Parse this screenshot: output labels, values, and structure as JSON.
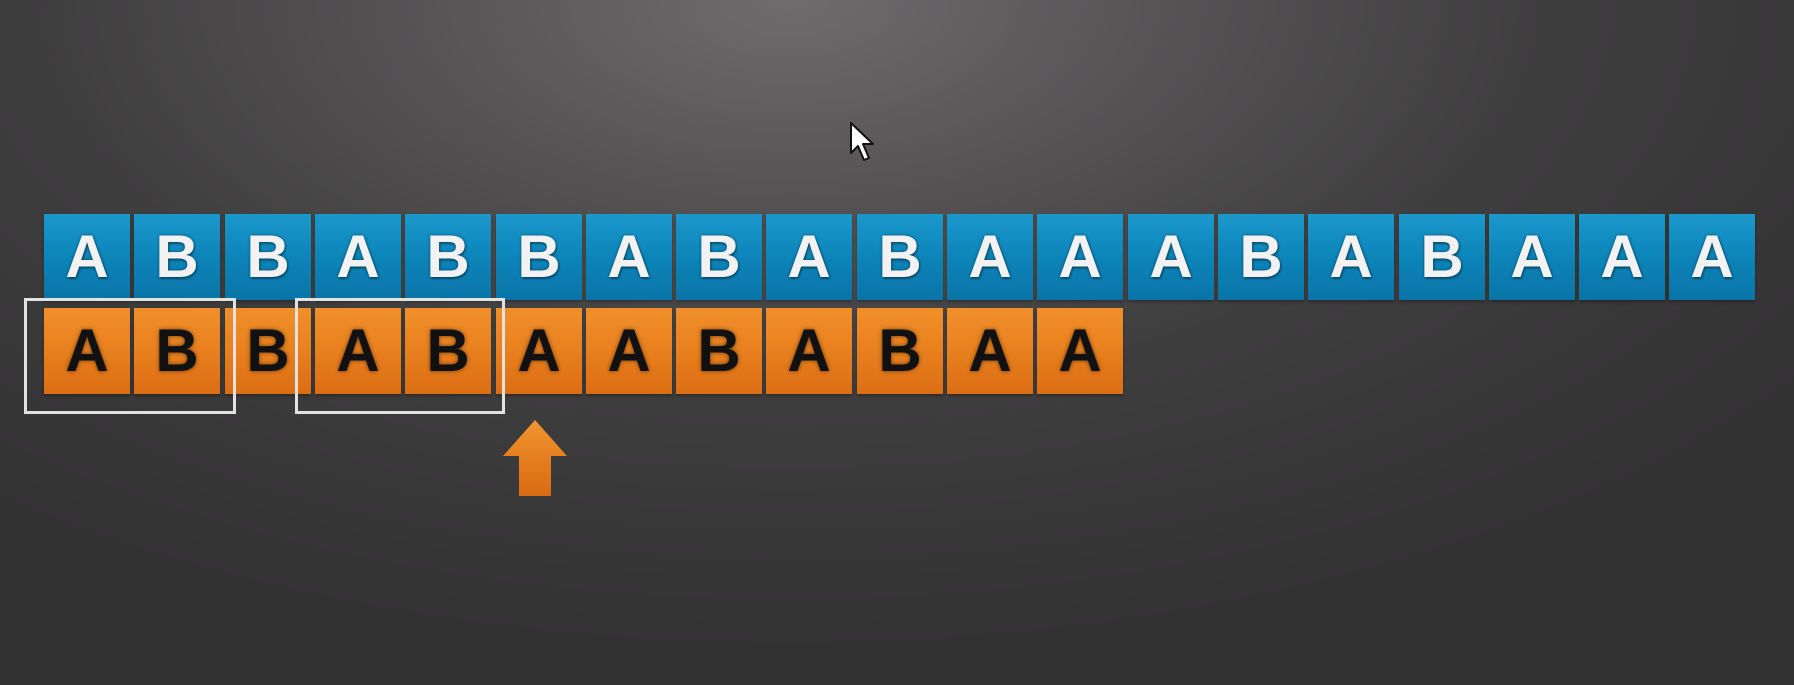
{
  "text_row": {
    "letters": [
      "A",
      "B",
      "B",
      "A",
      "B",
      "B",
      "A",
      "B",
      "A",
      "B",
      "A",
      "A",
      "A",
      "B",
      "A",
      "B",
      "A",
      "A",
      "A"
    ]
  },
  "pattern_row": {
    "letters": [
      "A",
      "B",
      "B",
      "A",
      "B",
      "A",
      "A",
      "B",
      "A",
      "B",
      "A",
      "A"
    ]
  },
  "highlights": [
    {
      "start": 0,
      "length": 2
    },
    {
      "start": 3,
      "length": 2
    }
  ],
  "pointer": {
    "index": 5,
    "icon": "up-arrow-icon"
  },
  "colors": {
    "text_tile": "#0c83b8",
    "pattern_tile": "#e8801e",
    "highlight_border": "#e2e2e2",
    "arrow": "#e8801e",
    "background": "#4a494a"
  }
}
